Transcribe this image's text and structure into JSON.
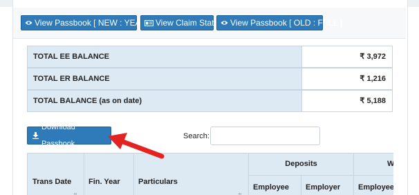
{
  "toolbar": {
    "buttons": [
      {
        "label": "View Passbook [ NEW : YEARLY ]",
        "icon": "eye-icon"
      },
      {
        "label": "View Claim Status",
        "icon": "card-icon"
      },
      {
        "label": "View Passbook [ OLD : FULL ]",
        "icon": "eye-icon"
      }
    ]
  },
  "balances": [
    {
      "label": "TOTAL EE BALANCE",
      "value": "₹ 3,972"
    },
    {
      "label": "TOTAL ER BALANCE",
      "value": "₹ 1,216"
    },
    {
      "label": "TOTAL BALANCE (as on date)",
      "value": "₹ 5,188"
    }
  ],
  "download": {
    "label": "Download Passbook",
    "icon": "download-icon"
  },
  "search": {
    "label": "Search:",
    "value": ""
  },
  "table_headers": {
    "trans_date": "Trans Date",
    "fin_year": "Fin. Year",
    "particulars": "Particulars",
    "deposits": "Deposits",
    "withdrawals": "W",
    "employee": "Employee",
    "employer": "Employer",
    "employee2": "Employee"
  },
  "colors": {
    "button": "#2f7ab8",
    "header_bg": "#dde9f3",
    "arrow": "#e32222"
  }
}
